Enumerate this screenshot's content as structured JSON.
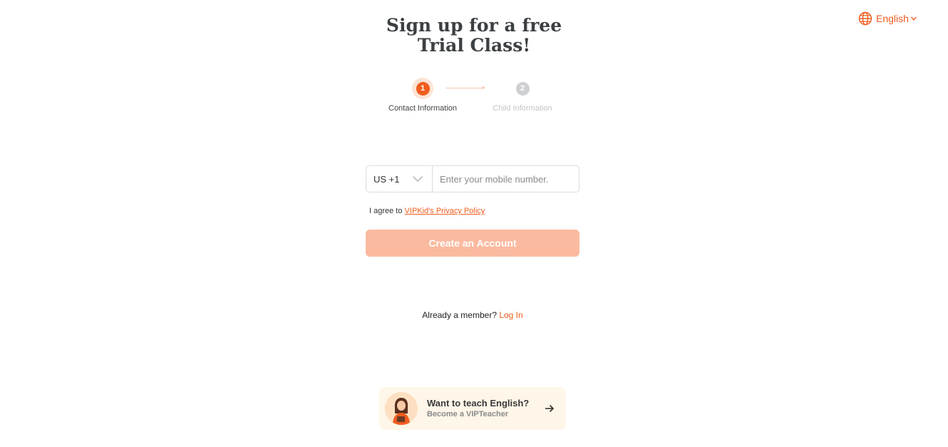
{
  "language": {
    "label": "English",
    "accent_color": "#f05c1e"
  },
  "page_title": "Sign up for a free Trial Class!",
  "steps": [
    {
      "number": "1",
      "label": "Contact Information",
      "state": "active"
    },
    {
      "number": "2",
      "label": "Child Information",
      "state": "inactive"
    }
  ],
  "phone": {
    "country_code": "US +1",
    "placeholder": "Enter your mobile number.",
    "value": ""
  },
  "agreement": {
    "text": "I agree to ",
    "link": "VIPKid's Privacy Policy"
  },
  "create_button": {
    "label": "Create an Account",
    "color": "#fbbaa0"
  },
  "member": {
    "text": "Already a member? ",
    "link": "Log In"
  },
  "teach_card": {
    "title": "Want to teach English?",
    "subtitle": "Become a VIPTeacher",
    "icon": "arrow-right-icon",
    "background": "#fef6e8"
  }
}
